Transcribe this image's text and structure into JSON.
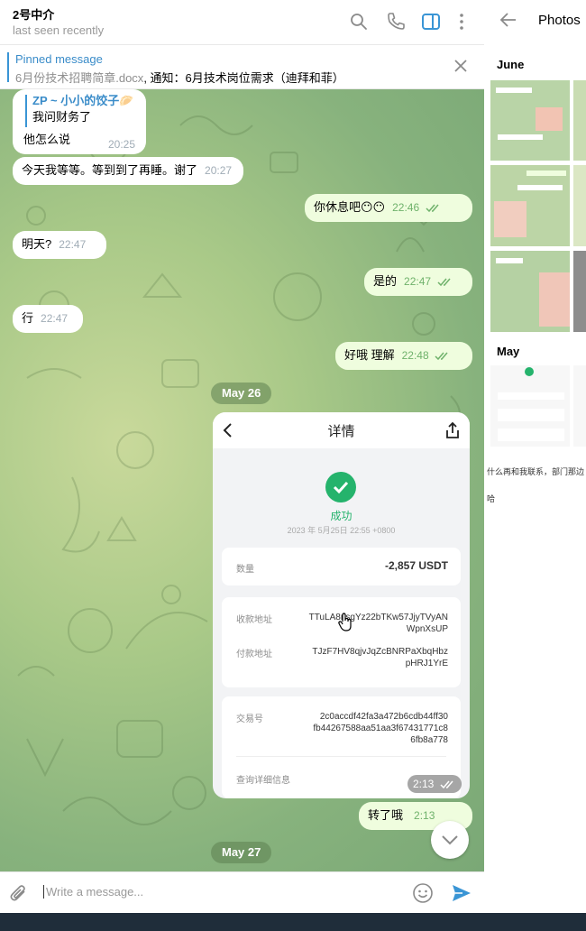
{
  "chat": {
    "title": "2号中介",
    "status": "last seen recently"
  },
  "pinned": {
    "label": "Pinned message",
    "file": "6月份技术招聘简章.docx",
    "separator": ", ",
    "text": "通知：6月技术岗位需求（迪拜和菲）"
  },
  "messages": {
    "m1_sender": "ZP ~ 小小的饺子🥟",
    "m1_quote": "我问财务了",
    "m1_text": "他怎么说",
    "m1_time": "20:25",
    "m2_text": "今天我等等。等到到了再睡。谢了",
    "m2_time": "20:27",
    "m3_text": "你休息吧😶😶",
    "m3_time": "22:46",
    "m4_text": "明天?",
    "m4_time": "22:47",
    "m5_text": "是的",
    "m5_time": "22:47",
    "m6_text": "行",
    "m6_time": "22:47",
    "m7_text": "好哦  理解",
    "m7_time": "22:48",
    "date1": "May 26",
    "shot_time": "2:13",
    "m8_text": "转了哦",
    "m8_time": "2:13",
    "date2": "May 27"
  },
  "receipt": {
    "title": "详情",
    "status": "成功",
    "datetime": "2023 年 5月25日 22:55 +0800",
    "amount_label": "数量",
    "amount": "-2,857 USDT",
    "to_label": "收款地址",
    "to_line1": "TTuLA8nsgYz22bTKw57JjyTVyAN",
    "to_line2": "WpnXsUP",
    "from_label": "付款地址",
    "from_line1": "TJzF7HV8qjvJqZcBNRPaXbqHbz",
    "from_line2": "pHRJ1YrE",
    "tx_label": "交易号",
    "tx_line1": "2c0accdf42fa3a472b6cdb44ff30",
    "tx_line2": "fb44267588aa51aa3f67431771c8",
    "tx_line3": "6fb8a778",
    "query": "查询详细信息"
  },
  "composer": {
    "placeholder": "Write a message..."
  },
  "panel": {
    "title": "Photos",
    "june": "June",
    "may": "May",
    "text1": "什么再和我联系，部门那边",
    "text2": "哈"
  },
  "colors": {
    "accent": "#3a95d5",
    "out_bubble": "#effdde",
    "success": "#25b36c"
  },
  "icons": [
    "search-icon",
    "phone-icon",
    "sidebar-icon",
    "more-icon",
    "close-icon",
    "back-icon",
    "attach-icon",
    "emoji-icon",
    "send-icon",
    "share-icon",
    "check-icon",
    "chevron-down-icon"
  ]
}
